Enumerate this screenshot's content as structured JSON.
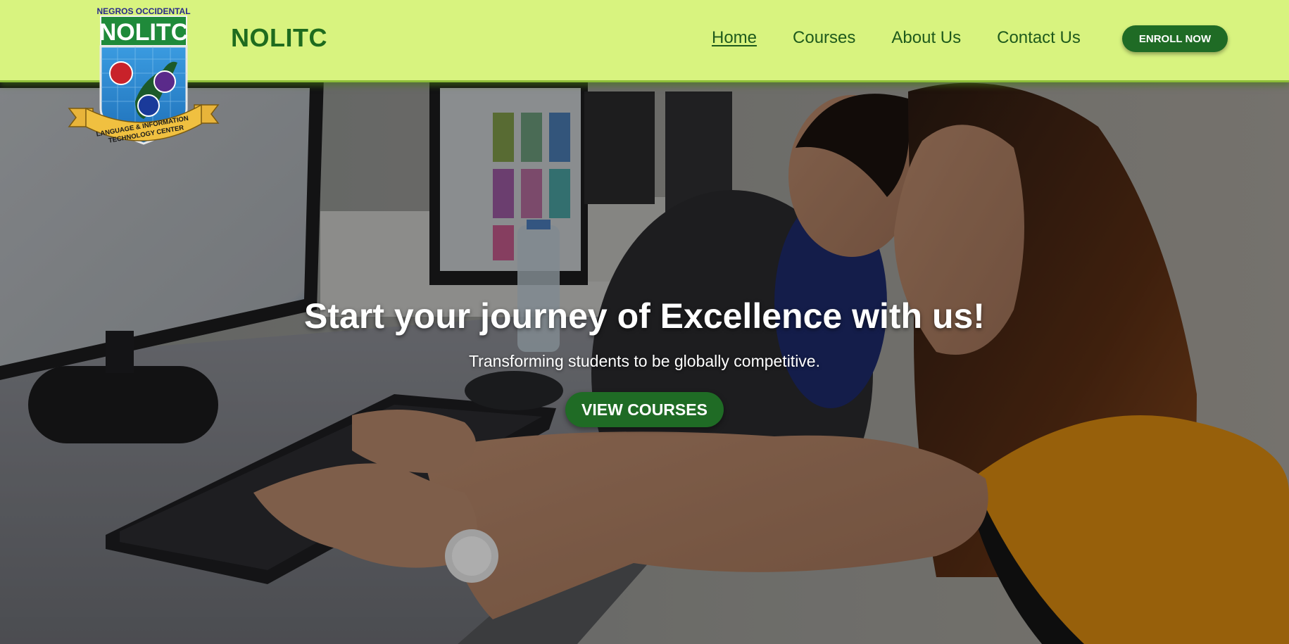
{
  "brand": {
    "name": "NOLITC",
    "logo": {
      "top_text": "NEGROS OCCIDENTAL",
      "main_text": "NOLITC",
      "ribbon_line1": "LANGUAGE & INFORMATION",
      "ribbon_line2": "TECHNOLOGY CENTER"
    }
  },
  "nav": {
    "items": [
      {
        "label": "Home",
        "active": true
      },
      {
        "label": "Courses",
        "active": false
      },
      {
        "label": "About Us",
        "active": false
      },
      {
        "label": "Contact Us",
        "active": false
      }
    ],
    "enroll_label": "ENROLL NOW"
  },
  "hero": {
    "title": "Start your journey of Excellence with us!",
    "subtitle": "Transforming students to be globally competitive.",
    "cta_label": "VIEW COURSES",
    "image": "hero-photo"
  },
  "colors": {
    "navbar_bg": "#d8f37f",
    "brand_green": "#1e6b1e",
    "button_green": "#1f6b25",
    "text_white": "#ffffff"
  }
}
